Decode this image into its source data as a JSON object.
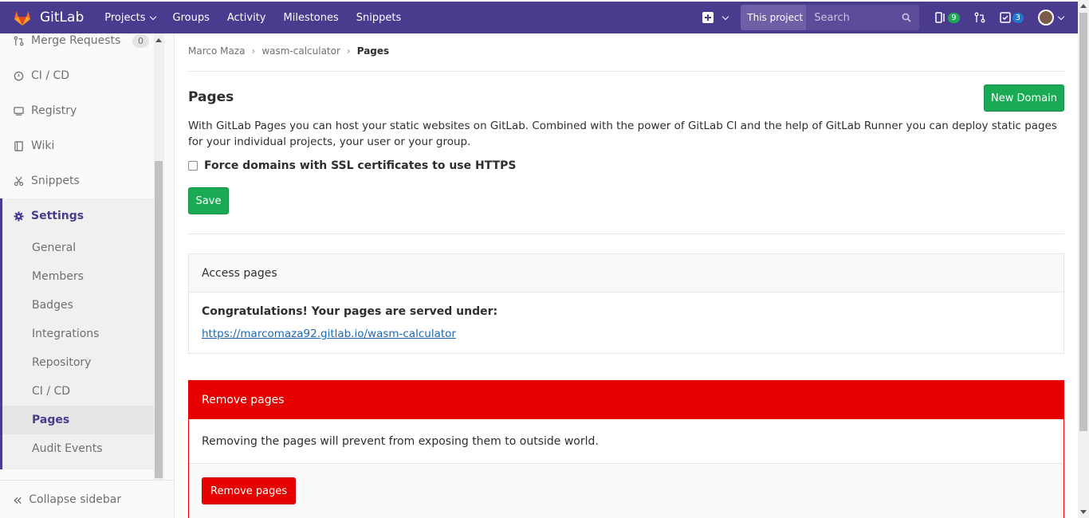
{
  "navbar": {
    "brand": "GitLab",
    "links": [
      "Projects",
      "Groups",
      "Activity",
      "Milestones",
      "Snippets"
    ],
    "search_scope": "This project",
    "search_placeholder": "Search",
    "issues_count": "9",
    "todos_count": "3"
  },
  "sidebar": {
    "items": [
      {
        "label": "Merge Requests",
        "icon": "merge-request-icon",
        "count": "0"
      },
      {
        "label": "CI / CD",
        "icon": "rocket-icon"
      },
      {
        "label": "Registry",
        "icon": "container-icon"
      },
      {
        "label": "Wiki",
        "icon": "book-icon"
      },
      {
        "label": "Snippets",
        "icon": "scissors-icon"
      }
    ],
    "settings_label": "Settings",
    "settings_icon": "gear-icon",
    "settings_items": [
      "General",
      "Members",
      "Badges",
      "Integrations",
      "Repository",
      "CI / CD",
      "Pages",
      "Audit Events"
    ],
    "collapse_label": "Collapse sidebar"
  },
  "breadcrumb": [
    "Marco Maza",
    "wasm-calculator",
    "Pages"
  ],
  "page": {
    "title": "Pages",
    "new_domain_label": "New Domain",
    "description": "With GitLab Pages you can host your static websites on GitLab. Combined with the power of GitLab CI and the help of GitLab Runner you can deploy static pages for your individual projects, your user or your group.",
    "https_label": "Force domains with SSL certificates to use HTTPS",
    "save_label": "Save"
  },
  "access": {
    "heading": "Access pages",
    "congrats": "Congratulations! Your pages are served under:",
    "url": "https://marcomaza92.gitlab.io/wasm-calculator"
  },
  "remove": {
    "heading": "Remove pages",
    "text": "Removing the pages will prevent from exposing them to outside world.",
    "button_label": "Remove pages"
  },
  "colors": {
    "navbar": "#4b3b8f",
    "accent": "#1aaa55",
    "danger": "#e70000"
  }
}
